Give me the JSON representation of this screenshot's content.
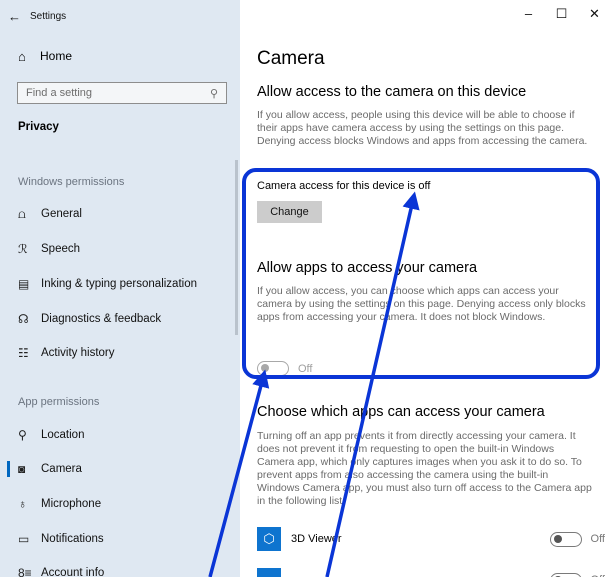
{
  "window": {
    "title": "Settings",
    "back_glyph": "←",
    "minimize": "–",
    "maximize": "☐",
    "close": "✕"
  },
  "sidebar": {
    "home": "Home",
    "search_placeholder": "Find a setting",
    "category": "Privacy",
    "windows_permissions": "Windows permissions",
    "items": [
      {
        "label": "General",
        "icon": "lock-icon",
        "glyph": "🔒"
      },
      {
        "label": "Speech",
        "icon": "speech-icon",
        "glyph": "ℛ"
      },
      {
        "label": "Inking & typing personalization",
        "icon": "clipboard-icon",
        "glyph": "▤"
      },
      {
        "label": "Diagnostics & feedback",
        "icon": "feedback-icon",
        "glyph": "⎈"
      },
      {
        "label": "Activity history",
        "icon": "timeline-icon",
        "glyph": "☷"
      }
    ],
    "app_permissions": "App permissions",
    "app_items": [
      {
        "label": "Location",
        "icon": "location-icon",
        "glyph": "⚲"
      },
      {
        "label": "Camera",
        "icon": "camera-icon",
        "glyph": "◙",
        "active": true
      },
      {
        "label": "Microphone",
        "icon": "microphone-icon",
        "glyph": "🎙"
      },
      {
        "label": "Notifications",
        "icon": "notifications-icon",
        "glyph": "▭"
      },
      {
        "label": "Account info",
        "icon": "account-info-icon",
        "glyph": "8≡"
      }
    ]
  },
  "main": {
    "title": "Camera",
    "device_heading": "Allow access to the camera on this device",
    "device_desc": "If you allow access, people using this device will be able to choose if their apps have camera access by using the settings on this page. Denying access blocks Windows and apps from accessing the camera.",
    "device_status": "Camera access for this device is off",
    "change_button": "Change",
    "apps_heading": "Allow apps to access your camera",
    "apps_desc": "If you allow access, you can choose which apps can access your camera by using the settings on this page. Denying access only blocks apps from accessing your camera. It does not block Windows.",
    "apps_toggle_state": "Off",
    "choose_heading": "Choose which apps can access your camera",
    "choose_desc": "Turning off an app prevents it from directly accessing your camera. It does not prevent it from requesting to open the built-in Windows Camera app, which only captures images when you ask it to do so. To prevent apps from also accessing the camera using the built-in Windows Camera app, you must also turn off access to the Camera app in the following list.",
    "apps": [
      {
        "name": "3D Viewer",
        "state": "Off",
        "icon": "cube-icon",
        "glyph": "⬡"
      },
      {
        "name": "",
        "state": "Off",
        "icon": "app-icon",
        "glyph": ""
      }
    ]
  },
  "colors": {
    "sidebar_bg": "#dfe8f2",
    "accent": "#0067c0",
    "annotation": "#0a35d6"
  }
}
